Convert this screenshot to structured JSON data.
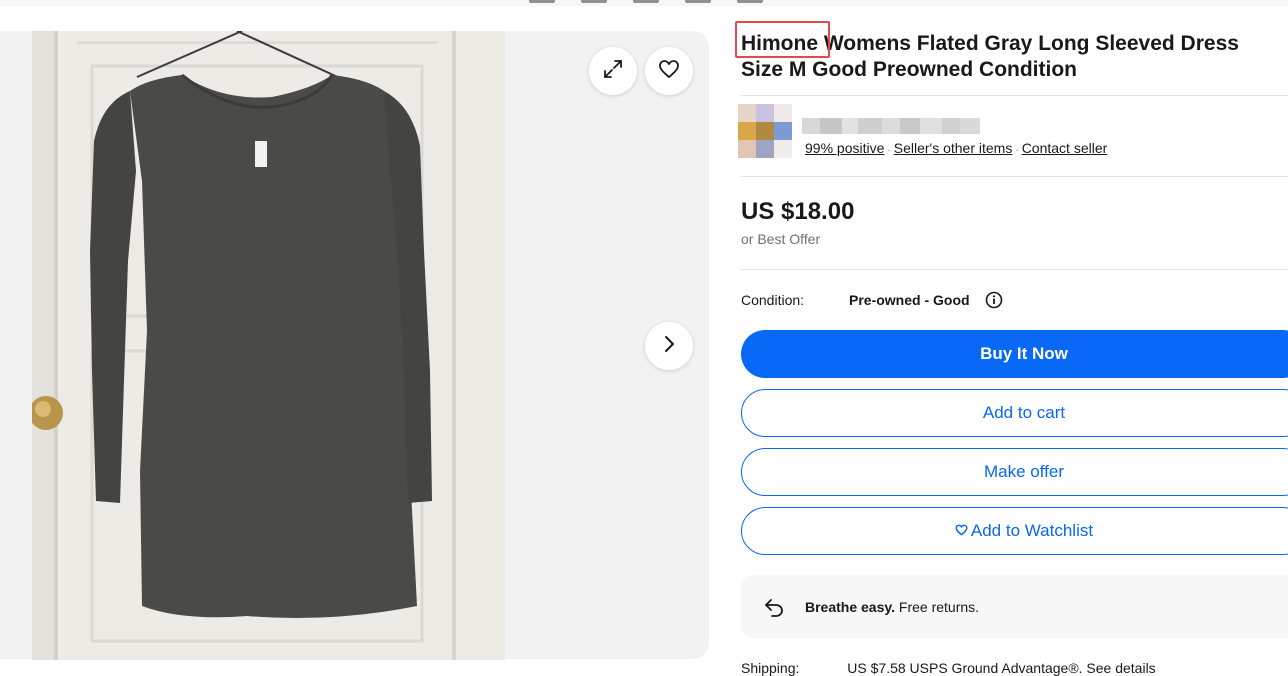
{
  "listing": {
    "title_brand": "Himone",
    "title_rest": " Womens Flated Gray Long Sleeved Dress Size M Good Preowned Condition"
  },
  "seller": {
    "feedback": "99% positive",
    "other_items": "Seller's other items",
    "contact": "Contact seller"
  },
  "pricing": {
    "price": "US $18.00",
    "best_offer": "or Best Offer"
  },
  "condition": {
    "label": "Condition:",
    "value": "Pre-owned - Good"
  },
  "actions": {
    "buy_now": "Buy It Now",
    "add_to_cart": "Add to cart",
    "make_offer": "Make offer",
    "watchlist": "Add to Watchlist"
  },
  "returns": {
    "bold": "Breathe easy.",
    "text": " Free returns."
  },
  "shipping": {
    "label": "Shipping:",
    "text": "US $7.58 USPS Ground Advantage®. See details"
  },
  "colors": {
    "accent_blue": "#0968f6",
    "highlight_red": "#e5484d",
    "gallery_bg": "#f2f2f2"
  },
  "icons": [
    "expand-icon",
    "heart-icon",
    "chevron-right-icon",
    "info-icon",
    "return-arrow-icon"
  ]
}
